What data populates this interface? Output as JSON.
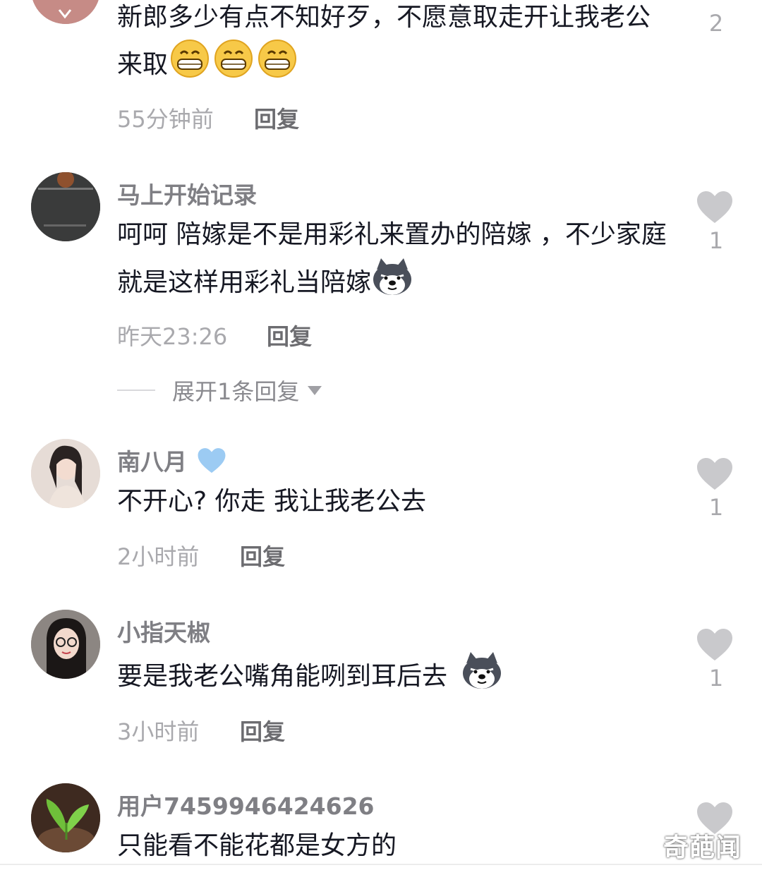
{
  "comments": [
    {
      "text": "新郎多少有点不知好歹，不愿意取走开让我老公来取",
      "emoji": "grin-emoji x3",
      "time": "55分钟前",
      "reply_label": "回复",
      "likes": "2"
    },
    {
      "username": "马上开始记录",
      "text": "呵呵 陪嫁是不是用彩礼来置办的陪嫁 ，不少家庭就是这样用彩礼当陪嫁",
      "emoji": "husky-emoji",
      "time": "昨天23:26",
      "reply_label": "回复",
      "likes": "1",
      "expand_label": "展开1条回复"
    },
    {
      "username": "南八月",
      "username_badge": "blue-heart-icon",
      "text": "不开心? 你走 我让我老公去",
      "time": "2小时前",
      "reply_label": "回复",
      "likes": "1"
    },
    {
      "username": "小指天椒",
      "text": "要是我老公嘴角能咧到耳后去",
      "emoji": "husky-emoji",
      "time": "3小时前",
      "reply_label": "回复",
      "likes": "1"
    },
    {
      "username": "用户7459946424626",
      "text": "只能看不能花都是女方的"
    }
  ],
  "watermark": "奇葩闻",
  "colors": {
    "username": "#7f7f84",
    "text": "#161823",
    "meta": "#a9a9ad",
    "heart": "#c9c9cc",
    "blue_heart": "#9ccbf3"
  }
}
